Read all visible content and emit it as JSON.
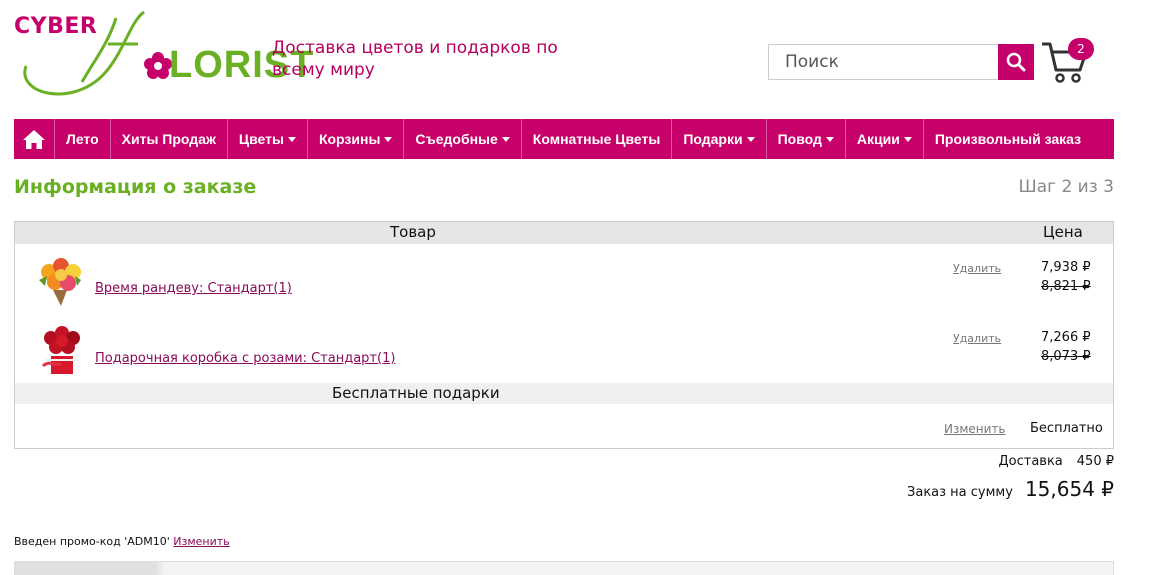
{
  "header": {
    "logo_text_top": "CYBER",
    "logo_text_bottom": "LORIST",
    "tagline": "Доставка цветов и подарков по всему миру",
    "search_placeholder": "Поиск",
    "cart_count": "2"
  },
  "nav": {
    "items": [
      {
        "label": "Лето",
        "dropdown": false
      },
      {
        "label": "Хиты Продаж",
        "dropdown": false
      },
      {
        "label": "Цветы",
        "dropdown": true
      },
      {
        "label": "Корзины",
        "dropdown": true
      },
      {
        "label": "Съедобные",
        "dropdown": true
      },
      {
        "label": "Комнатные Цветы",
        "dropdown": false
      },
      {
        "label": "Подарки",
        "dropdown": true
      },
      {
        "label": "Повод",
        "dropdown": true
      },
      {
        "label": "Акции",
        "dropdown": true
      },
      {
        "label": "Произвольный заказ",
        "dropdown": false
      }
    ],
    "accent": "#c8006a"
  },
  "page": {
    "title": "Информация о заказе",
    "step": "Шаг 2 из 3"
  },
  "order": {
    "col_product": "Товар",
    "col_price": "Цена",
    "items": [
      {
        "name": "Время рандеву: Стандарт(1)",
        "remove": "Удалить",
        "price": "7,938 ₽",
        "old_price": "8,821 ₽"
      },
      {
        "name": "Подарочная коробка с розами: Стандарт(1)",
        "remove": "Удалить",
        "price": "7,266 ₽",
        "old_price": "8,073 ₽"
      }
    ],
    "gifts_header": "Бесплатные подарки",
    "gifts_change": "Изменить",
    "gifts_value": "Бесплатно"
  },
  "totals": {
    "delivery_label": "Доставка",
    "delivery_value": "450 ₽",
    "total_label": "Заказ на сумму",
    "total_value": "15,654 ₽"
  },
  "promo": {
    "text": "Введен промо-код 'ADM10'",
    "change": "Изменить"
  }
}
